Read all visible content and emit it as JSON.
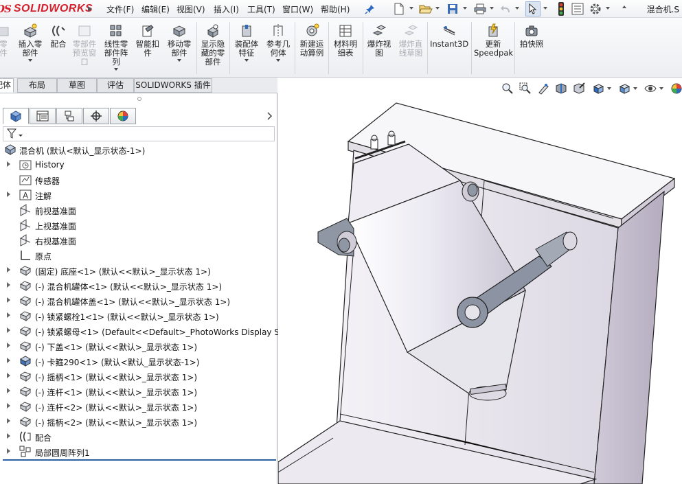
{
  "app": {
    "logo_ds": "DS",
    "logo_text": "SOLIDWORKS",
    "doc_title": "混合机.S"
  },
  "menu": [
    {
      "label": "文件(F)"
    },
    {
      "label": "编辑(E)"
    },
    {
      "label": "视图(V)"
    },
    {
      "label": "插入(I)"
    },
    {
      "label": "工具(T)"
    },
    {
      "label": "窗口(W)"
    },
    {
      "label": "帮助(H)"
    }
  ],
  "quick_access": [
    "new-icon",
    "open-icon",
    "save-icon",
    "print-icon",
    "undo-icon",
    "select-icon",
    "rebuild-icon",
    "file-properties-icon",
    "options-icon"
  ],
  "commands": [
    {
      "label": "零\n件",
      "disabled": true
    },
    {
      "label": "插入零\n部件",
      "disabled": false
    },
    {
      "label": "配合",
      "disabled": false
    },
    {
      "label": "零部件\n预览窗\n口",
      "disabled": true
    },
    {
      "label": "线性零\n部件阵\n列",
      "disabled": false
    },
    {
      "label": "智能扣\n件",
      "disabled": false
    },
    {
      "label": "移动零\n部件",
      "disabled": false
    },
    {
      "label": "显示隐\n藏的零\n部件",
      "disabled": false
    },
    {
      "label": "装配体\n特征",
      "disabled": false
    },
    {
      "label": "参考几\n何体",
      "disabled": false
    },
    {
      "label": "新建运\n动算例",
      "disabled": false
    },
    {
      "label": "材料明\n细表",
      "disabled": false
    },
    {
      "label": "爆炸视\n图",
      "disabled": false
    },
    {
      "label": "爆炸直\n线草图",
      "disabled": true
    },
    {
      "label": "Instant3D",
      "disabled": false
    },
    {
      "label": "更新\nSpeedpak",
      "disabled": false
    },
    {
      "label": "拍快照",
      "disabled": false
    }
  ],
  "tabs": [
    {
      "label": "装配体",
      "active": true
    },
    {
      "label": "布局"
    },
    {
      "label": "草图"
    },
    {
      "label": "评估"
    },
    {
      "label": "SOLIDWORKS 插件"
    }
  ],
  "feature_manager": {
    "tabs": [
      "featuremanager-icon",
      "propertymanager-icon",
      "configurationmanager-icon",
      "dimxpert-icon",
      "display-manager-icon"
    ],
    "root": "混合机  (默认<默认_显示状态-1>)",
    "items": [
      {
        "label": "History",
        "icon": "history-icon",
        "expand": true
      },
      {
        "label": "传感器",
        "icon": "sensor-icon",
        "expand": false
      },
      {
        "label": "注解",
        "icon": "annotation-icon",
        "expand": true
      },
      {
        "label": "前视基准面",
        "icon": "plane-icon",
        "expand": false
      },
      {
        "label": "上视基准面",
        "icon": "plane-icon",
        "expand": false
      },
      {
        "label": "右视基准面",
        "icon": "plane-icon",
        "expand": false
      },
      {
        "label": "原点",
        "icon": "origin-icon",
        "expand": false
      },
      {
        "label": "(固定) 底座<1> (默认<<默认>_显示状态 1>)",
        "icon": "part-icon",
        "expand": true
      },
      {
        "label": "(-) 混合机罐体<1> (默认<<默认>_显示状态 1>)",
        "icon": "part-icon",
        "expand": true
      },
      {
        "label": "(-) 混合机罐体盖<1> (默认<<默认>_显示状态 1>)",
        "icon": "part-icon",
        "expand": true
      },
      {
        "label": "(-) 锁紧螺栓1<1> (默认<<默认>_显示状态 1>)",
        "icon": "part-icon",
        "expand": true
      },
      {
        "label": "(-) 锁紧螺母<1> (Default<<Default>_PhotoWorks Display Sta",
        "icon": "part-icon",
        "expand": true
      },
      {
        "label": "(-) 下盖<1> (默认<<默认>_显示状态 1>)",
        "icon": "part-icon",
        "expand": true
      },
      {
        "label": "(-) 卡箍290<1> (默认<默认_显示状态-1>)",
        "icon": "subassembly-icon",
        "expand": true
      },
      {
        "label": "(-) 摇柄<1> (默认<<默认>_显示状态 1>)",
        "icon": "part-icon",
        "expand": true
      },
      {
        "label": "(-) 连杆<1> (默认<<默认>_显示状态 1>)",
        "icon": "part-icon",
        "expand": true
      },
      {
        "label": "(-) 连杆<2> (默认<<默认>_显示状态 1>)",
        "icon": "part-icon",
        "expand": true
      },
      {
        "label": "(-) 摇柄<2> (默认<<默认>_显示状态 1>)",
        "icon": "part-icon",
        "expand": true
      },
      {
        "label": "配合",
        "icon": "mates-icon",
        "expand": true
      },
      {
        "label": "局部圆周阵列1",
        "icon": "circular-pattern-icon",
        "expand": true
      }
    ]
  },
  "hud": [
    "zoom-to-fit-icon",
    "zoom-to-area-icon",
    "previous-view-icon",
    "section-view-icon",
    "dynamic-annotation-icon",
    "view-orientation-icon",
    "display-style-icon",
    "hide-show-icon",
    "appearance-icon"
  ]
}
